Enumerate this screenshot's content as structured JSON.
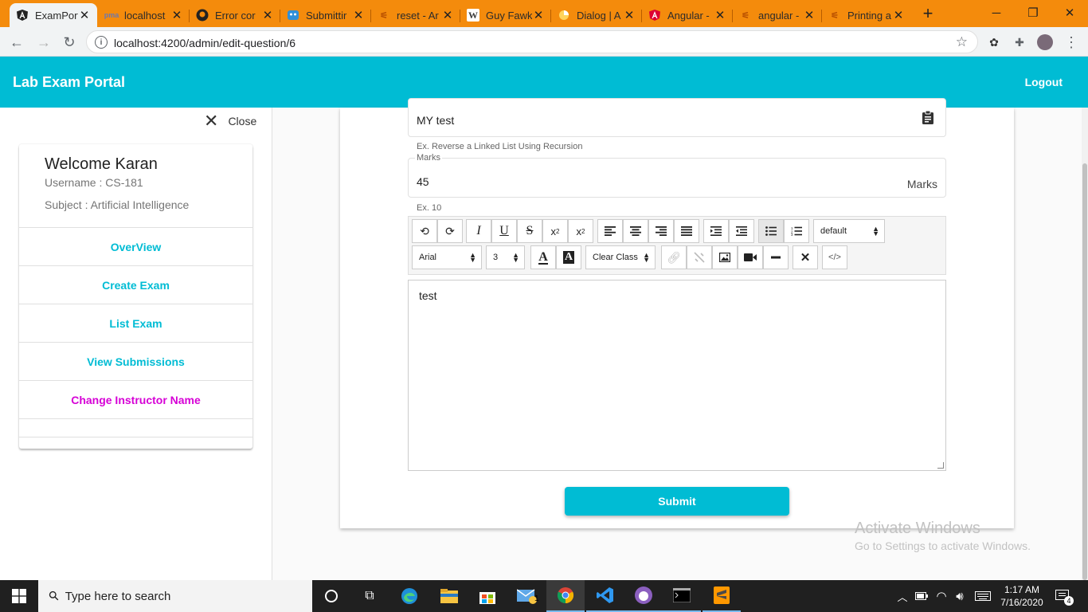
{
  "browser": {
    "tabs": [
      {
        "title": "ExamPort",
        "active": true,
        "icon": "angular-logo-icon"
      },
      {
        "title": "localhost",
        "icon": "phpmyadmin-icon"
      },
      {
        "title": "Error cor",
        "icon": "github-icon"
      },
      {
        "title": "Submittir",
        "icon": "app-icon"
      },
      {
        "title": "reset - Ar",
        "icon": "stackoverflow-icon"
      },
      {
        "title": "Guy Fawk",
        "icon": "wikipedia-icon"
      },
      {
        "title": "Dialog | A",
        "icon": "material-icon"
      },
      {
        "title": "Angular -",
        "icon": "angular-icon"
      },
      {
        "title": "angular -",
        "icon": "stackoverflow-icon"
      },
      {
        "title": "Printing a",
        "icon": "stackoverflow-icon"
      }
    ],
    "url": "localhost:4200/admin/edit-question/6"
  },
  "header": {
    "title": "Lab Exam Portal",
    "logout_label": "Logout"
  },
  "sidebar": {
    "close_label": "Close",
    "welcome": "Welcome Karan",
    "username": "Username : CS-181",
    "subject": "Subject : Artificial Intelligence",
    "nav": [
      {
        "label": "OverView"
      },
      {
        "label": "Create Exam"
      },
      {
        "label": "List Exam"
      },
      {
        "label": "View Submissions"
      },
      {
        "label": "Change Instructor Name"
      }
    ]
  },
  "form": {
    "title_value": "MY test",
    "title_hint": "Ex. Reverse a Linked List Using Recursion",
    "marks_label": "Marks",
    "marks_value": "45",
    "marks_suffix": "Marks",
    "marks_hint": "Ex. 10",
    "toolbar": {
      "style_select": "default",
      "font_select": "Arial",
      "size_select": "3",
      "class_select": "Clear Class"
    },
    "editor_content": "test",
    "submit_label": "Submit"
  },
  "watermark": {
    "line1": "Activate Windows",
    "line2": "Go to Settings to activate Windows."
  },
  "taskbar": {
    "search_placeholder": "Type here to search",
    "time": "1:17 AM",
    "date": "7/16/2020",
    "mail_badge": "1",
    "notifications": "4"
  },
  "colors": {
    "brand": "#00bcd4",
    "tabstrip": "#f48b0c",
    "nav_highlight": "#d600d6"
  }
}
